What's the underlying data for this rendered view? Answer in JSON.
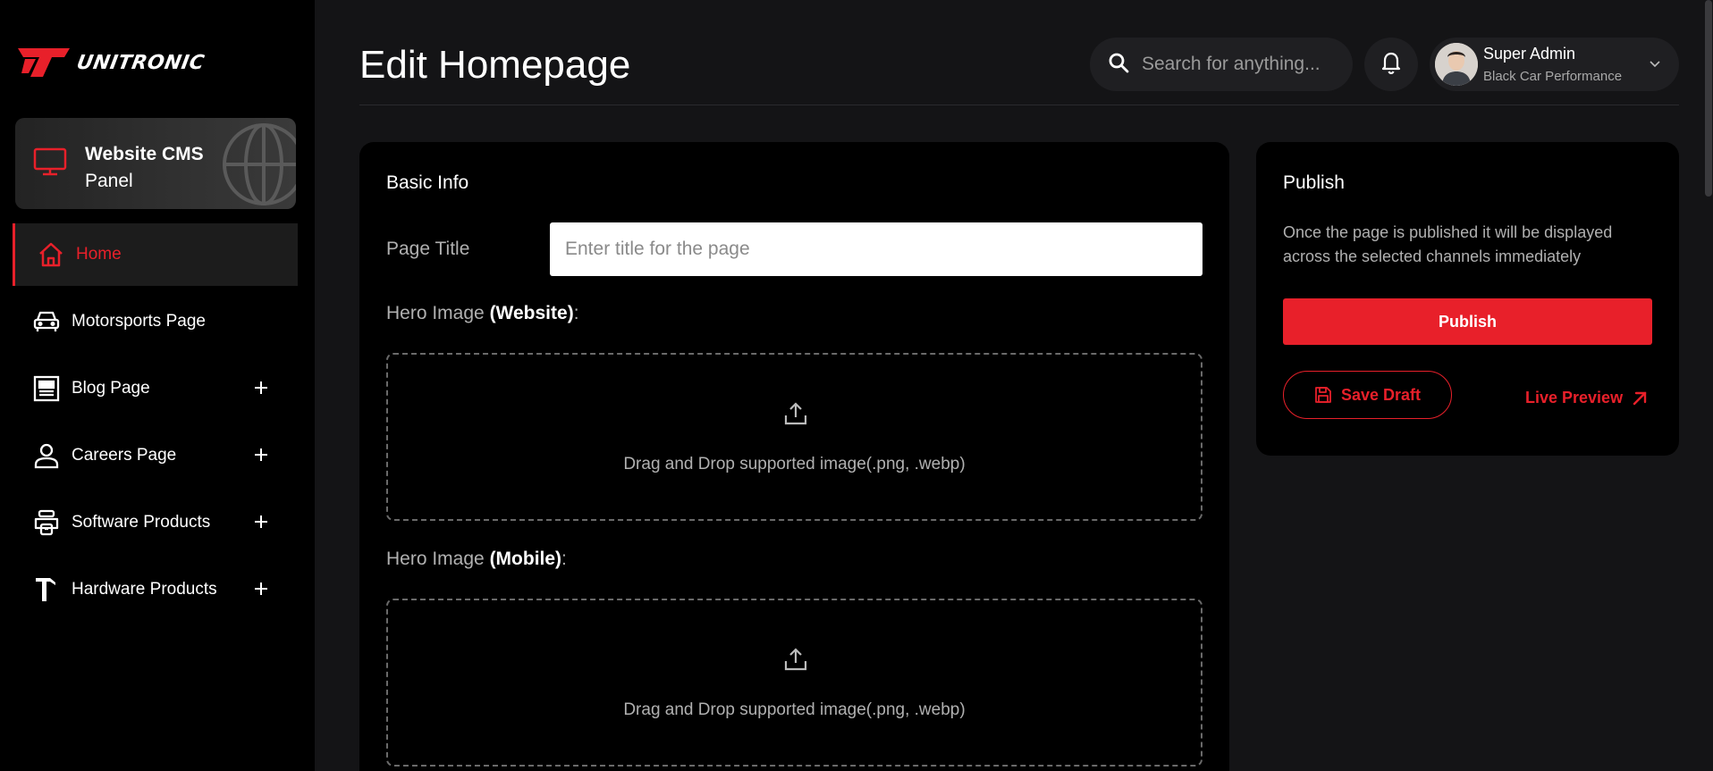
{
  "brand": {
    "name": "UNITRONIC",
    "accent": "#e8202a"
  },
  "sidebar": {
    "cms_card": {
      "title": "Website CMS",
      "subtitle": "Panel"
    },
    "items": [
      {
        "label": "Home",
        "icon": "home-icon",
        "active": true
      },
      {
        "label": "Motorsports Page",
        "icon": "car-icon"
      },
      {
        "label": "Blog Page",
        "icon": "blog-icon",
        "expandable": true
      },
      {
        "label": "Careers Page",
        "icon": "user-icon",
        "expandable": true
      },
      {
        "label": "Software Products",
        "icon": "software-icon",
        "expandable": true
      },
      {
        "label": "Hardware Products",
        "icon": "hardware-icon",
        "expandable": true
      }
    ]
  },
  "header": {
    "title": "Edit Homepage",
    "search_placeholder": "Search for anything...",
    "user": {
      "name": "Super Admin",
      "org": "Black Car Performance"
    }
  },
  "basic_info": {
    "title": "Basic Info",
    "page_title_label": "Page Title",
    "page_title_placeholder": "Enter title for the page",
    "hero_website_label": "Hero Image",
    "hero_website_suffix": "(Website)",
    "hero_mobile_label": "Hero Image",
    "hero_mobile_suffix": "(Mobile)",
    "drop_text": "Drag and Drop supported image(.png, .webp)"
  },
  "publish": {
    "title": "Publish",
    "description": "Once the page is published it will be displayed across the selected channels immediately",
    "publish_label": "Publish",
    "save_draft_label": "Save Draft",
    "live_preview_label": "Live Preview"
  }
}
